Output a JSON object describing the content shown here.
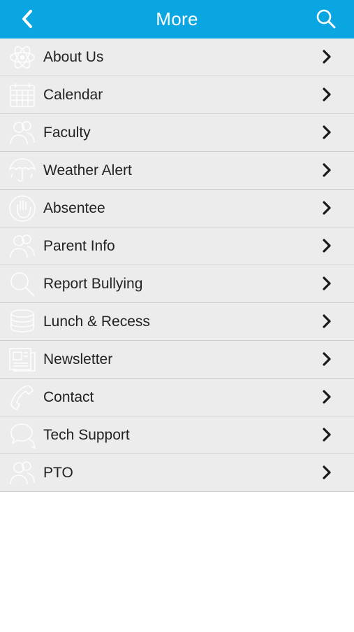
{
  "header": {
    "title": "More",
    "back_icon": "chevron-left-icon",
    "search_icon": "search-icon",
    "accent_color": "#0aa6e2"
  },
  "menu": {
    "items": [
      {
        "label": "About Us",
        "icon": "atom-icon"
      },
      {
        "label": "Calendar",
        "icon": "calendar-icon"
      },
      {
        "label": "Faculty",
        "icon": "people-icon"
      },
      {
        "label": "Weather Alert",
        "icon": "umbrella-icon"
      },
      {
        "label": "Absentee",
        "icon": "hand-icon"
      },
      {
        "label": "Parent Info",
        "icon": "people-icon"
      },
      {
        "label": "Report Bullying",
        "icon": "magnifier-icon"
      },
      {
        "label": "Lunch & Recess",
        "icon": "food-stack-icon"
      },
      {
        "label": "Newsletter",
        "icon": "newspaper-icon"
      },
      {
        "label": "Contact",
        "icon": "phone-handset-icon"
      },
      {
        "label": "Tech Support",
        "icon": "chat-bubbles-icon"
      },
      {
        "label": "PTO",
        "icon": "people-icon"
      }
    ]
  }
}
